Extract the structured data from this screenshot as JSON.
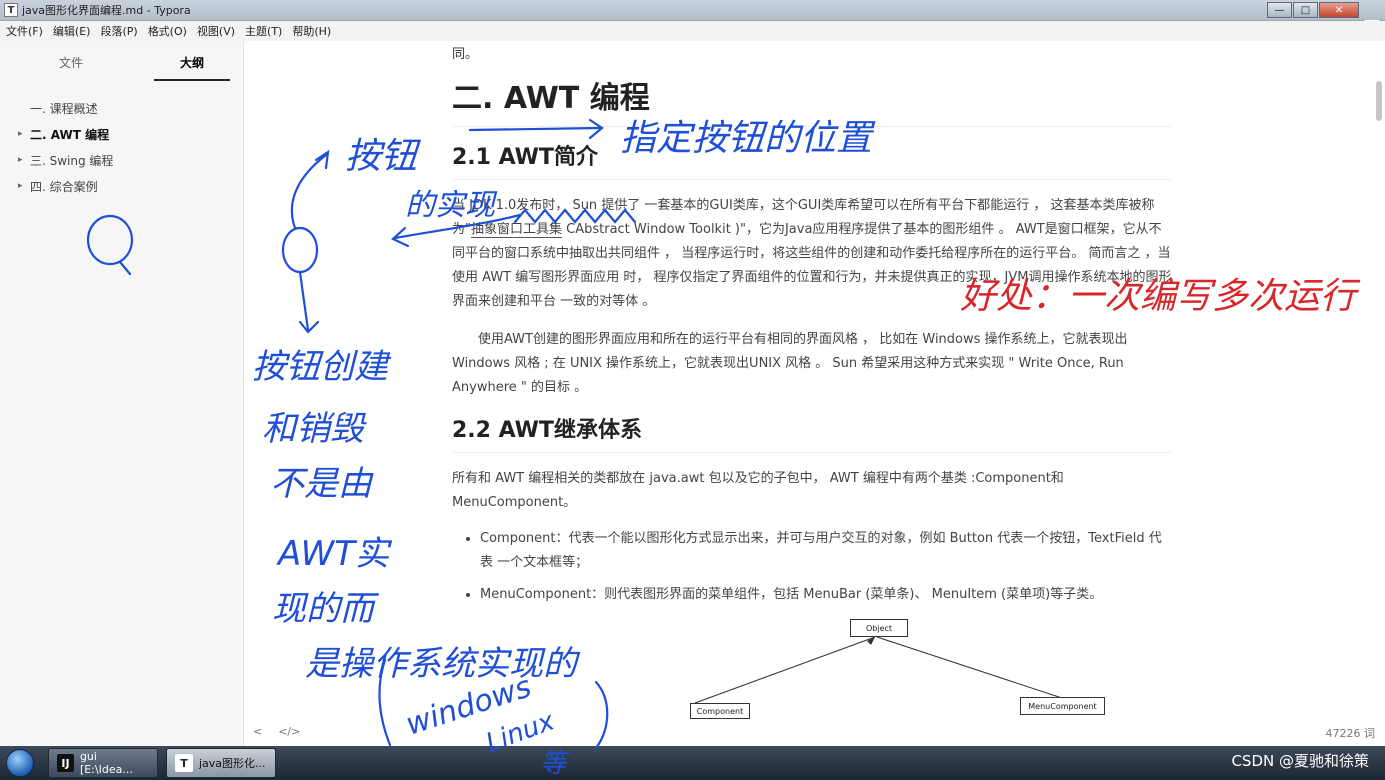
{
  "window": {
    "title": "java图形化界面编程.md - Typora",
    "icon_letter": "T",
    "badge": "¶"
  },
  "menu": [
    "文件(F)",
    "编辑(E)",
    "段落(P)",
    "格式(O)",
    "视图(V)",
    "主题(T)",
    "帮助(H)"
  ],
  "sidebar": {
    "tabs": [
      "文件",
      "大纲"
    ],
    "active_tab": "大纲",
    "outline": [
      {
        "label": "一. 课程概述",
        "expandable": false,
        "bold": false
      },
      {
        "label": "二. AWT 编程",
        "expandable": true,
        "bold": true
      },
      {
        "label": "三. Swing 编程",
        "expandable": true,
        "bold": false
      },
      {
        "label": "四. 综合案例",
        "expandable": true,
        "bold": false
      }
    ]
  },
  "doc": {
    "lead": "同。",
    "h2": "二. AWT 编程",
    "s1_title": "2.1 AWT简介",
    "s1_p1_a": "当 JDK 1.0发布时， Sun 提供了 一套基本的GUI类库，这个GUI类库希望可以在所有平台下都能运行 ， 这套基本类库被称为\"",
    "s1_p1_hl": "抽象窗口工具集",
    "s1_p1_b": " CAbstract Window Toolkit )\"，它为Java应用程序提供了基本的图形组件 。 AWT是窗口框架，它从不同平台的窗口系统中抽取出共同组件 ， 当程序运行时，将这些组件的创建和动作委托给程序所在的运行平台。 简而言之 ，当使用 AWT 编写图形界面应用 时， 程序仅指定了界面组件的位置和行为，并未提供真正的实现，JVM调用操作系统本地的图形界面来创建和平台 一致的对等体 。",
    "s1_p2": "使用AWT创建的图形界面应用和所在的运行平台有相同的界面风格 ， 比如在 Windows 操作系统上，它就表现出 Windows 风格 ; 在 UNIX 操作系统上，它就表现出UNIX 风格 。 Sun 希望采用这种方式来实现 \" Write Once, Run Anywhere \" 的目标 。",
    "s2_title": "2.2 AWT继承体系",
    "s2_p1": "所有和 AWT 编程相关的类都放在 java.awt 包以及它的子包中， AWT 编程中有两个基类 :Component和 MenuComponent。",
    "bullets": [
      "Component：代表一个能以图形化方式显示出来，并可与用户交互的对象，例如 Button 代表一个按钮，TextField 代表 一个文本框等；",
      "MenuComponent：则代表图形界面的菜单组件，包括 MenuBar (菜单条)、 MenuItem (菜单项)等子类。"
    ],
    "diagram": {
      "root": "Object",
      "left": "Component",
      "right": "MenuComponent"
    }
  },
  "footer": {
    "back": "<",
    "source": "</>",
    "word_count": "47226 词"
  },
  "taskbar": {
    "items": [
      {
        "label": "gui [E:\\Idea...",
        "icon": "IJ"
      },
      {
        "label": "java图形化...",
        "icon": "T"
      }
    ],
    "watermark": "CSDN @夏驰和徐策"
  },
  "annotations": {
    "button": "按钮",
    "specify_pos": "指定按钮的位置",
    "impl": "的实现",
    "create_destroy": "按钮创建",
    "and_destroy": "和销毁",
    "not_by": "不是由",
    "awt": "AWT实",
    "impl_now": "现的而",
    "is_os": "是操作系统实现的",
    "windows": "windows",
    "linux": "Linux",
    "etc": "等",
    "benefit": "好处：一次编写多次运行",
    "ink_blue": "#1f4fd6",
    "ink_red": "#d9262a"
  }
}
